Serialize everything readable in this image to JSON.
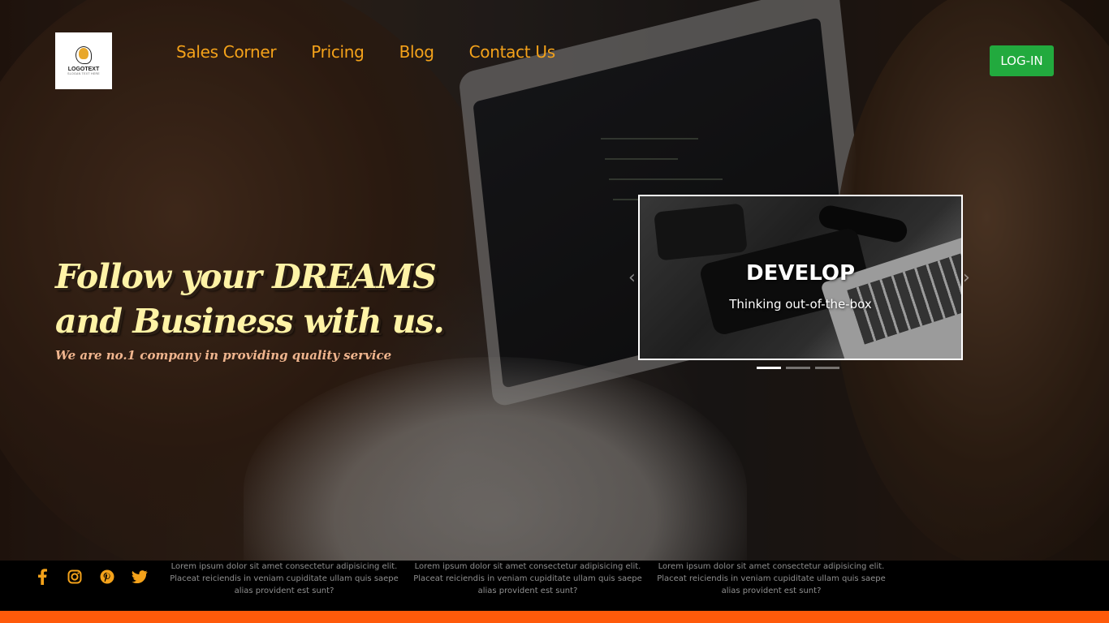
{
  "logo": {
    "name": "LOGOTEXT",
    "tagline": "SLOGAN TEXT HERE",
    "brand_color": "#e8a72a"
  },
  "nav": {
    "items": [
      "Sales Corner",
      "Pricing",
      "Blog",
      "Contact Us"
    ],
    "color": "#f4a21a"
  },
  "login": {
    "label": "LOG-IN",
    "color": "#22aa3e"
  },
  "hero": {
    "title_line1": "Follow your DREAMS",
    "title_line2": "and Business with us.",
    "subtitle": "We are no.1 company in providing quality service"
  },
  "carousel": {
    "title": "DEVELOP",
    "caption": "Thinking out-of-the-box",
    "prev_icon": "chevron-left-icon",
    "next_icon": "chevron-right-icon",
    "slide_count": 3,
    "active_index": 0
  },
  "footer": {
    "social_icons": [
      "facebook-icon",
      "instagram-icon",
      "pinterest-icon",
      "twitter-icon"
    ],
    "columns": [
      "Lorem ipsum dolor sit amet consectetur adipisicing elit. Placeat reiciendis in veniam cupiditate ullam quis saepe alias provident est sunt?",
      "Lorem ipsum dolor sit amet consectetur adipisicing elit. Placeat reiciendis in veniam cupiditate ullam quis saepe alias provident est sunt?",
      "Lorem ipsum dolor sit amet consectetur adipisicing elit. Placeat reiciendis in veniam cupiditate ullam quis saepe alias provident est sunt?"
    ],
    "accent_color": "#ff5a0a"
  }
}
